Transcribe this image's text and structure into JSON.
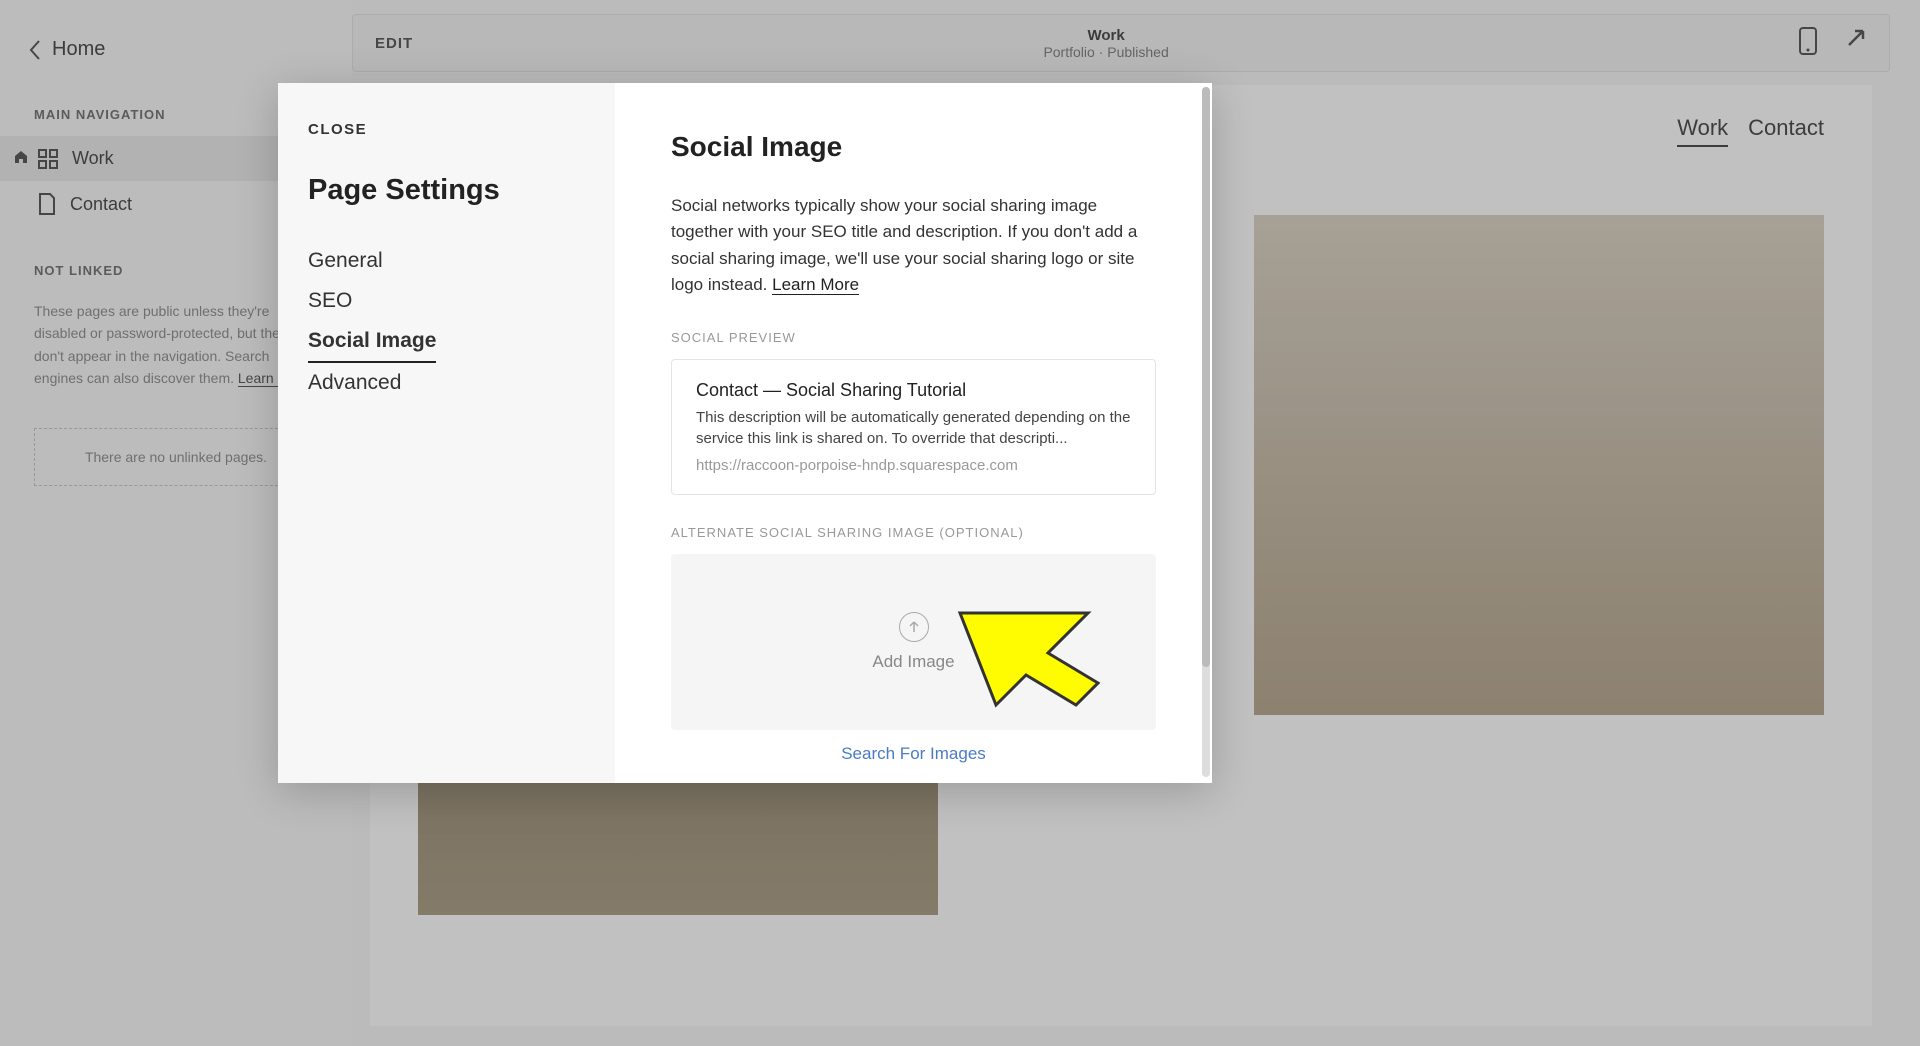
{
  "sidebar": {
    "home_label": "Home",
    "main_nav_heading": "MAIN NAVIGATION",
    "nav_items": [
      {
        "label": "Work"
      },
      {
        "label": "Contact"
      }
    ],
    "not_linked_heading": "NOT LINKED",
    "not_linked_text": "These pages are public unless they're disabled or password-protected, but they don't appear in the navigation. Search engines can also discover them.",
    "learn_more": "Learn more",
    "no_unlinked": "There are no unlinked pages."
  },
  "topbar": {
    "edit": "EDIT",
    "title": "Work",
    "subtitle": "Portfolio · Published"
  },
  "preview_nav": {
    "work": "Work",
    "contact": "Contact"
  },
  "modal": {
    "close": "CLOSE",
    "title": "Page Settings",
    "tabs": {
      "general": "General",
      "seo": "SEO",
      "social_image": "Social Image",
      "advanced": "Advanced"
    },
    "content": {
      "title": "Social Image",
      "description": "Social networks typically show your social sharing image together with your SEO title and description. If you don't add a social sharing image, we'll use your social sharing logo or site logo instead.",
      "learn_more": "Learn More",
      "social_preview_label": "SOCIAL PREVIEW",
      "preview_title": "Contact — Social Sharing Tutorial",
      "preview_desc": "This description will be automatically generated depending on the service this link is shared on. To override that descripti...",
      "preview_url": "https://raccoon-porpoise-hndp.squarespace.com",
      "alt_image_label": "ALTERNATE SOCIAL SHARING IMAGE (OPTIONAL)",
      "add_image": "Add Image",
      "search_images": "Search For Images"
    }
  }
}
